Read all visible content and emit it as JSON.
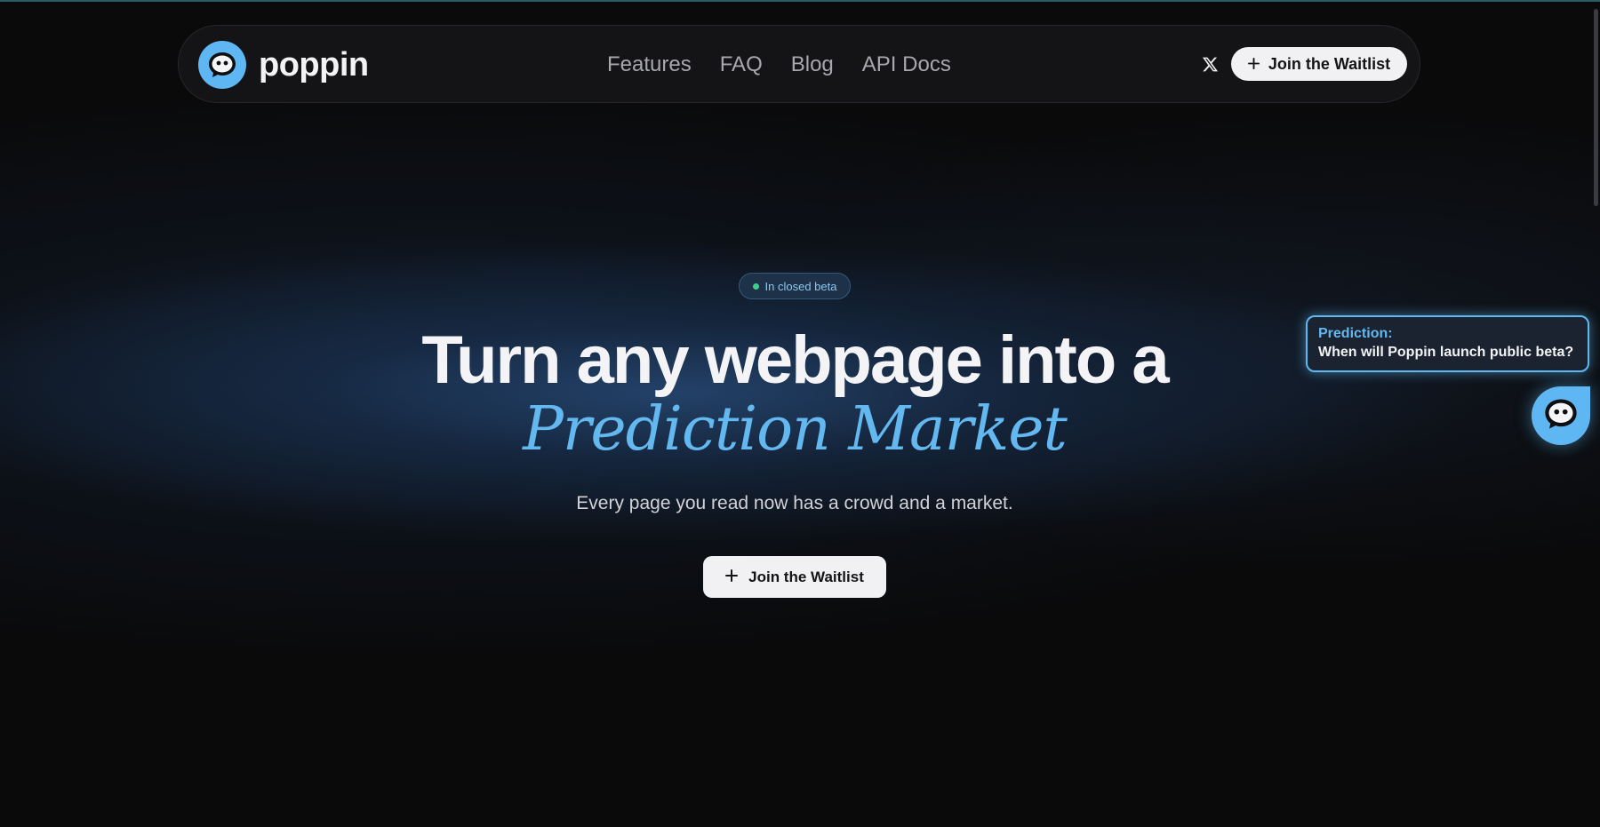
{
  "brand": {
    "name": "poppin",
    "logo_icon": "chat-bubble-face-icon",
    "accent_color": "#5eb7f2"
  },
  "nav": {
    "links": [
      "Features",
      "FAQ",
      "Blog",
      "API Docs"
    ],
    "x_icon": "x-logo-icon",
    "cta_label": "Join the Waitlist",
    "cta_icon": "plus-icon"
  },
  "hero": {
    "badge": "In closed beta",
    "title": "Turn any webpage into a",
    "title_accent": "Prediction Market",
    "subtitle": "Every page you read now has a crowd and a market.",
    "cta_label": "Join the Waitlist",
    "cta_icon": "plus-icon"
  },
  "widget": {
    "label": "Prediction:",
    "question": "When will Poppin launch public beta?",
    "bubble_icon": "chat-bubble-face-icon"
  },
  "colors": {
    "background": "#0a0a0b",
    "accent_blue": "#63b8ef",
    "badge_dot": "#3ecf8e",
    "button_bg": "#f1f1f3"
  }
}
